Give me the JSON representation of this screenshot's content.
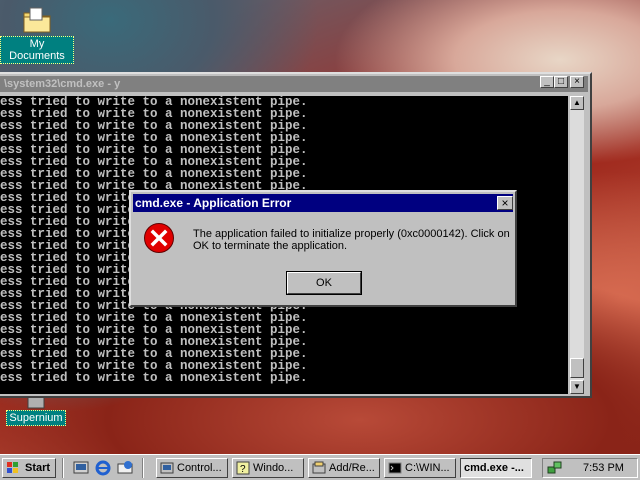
{
  "desktop": {
    "icons": [
      {
        "label": "My Documents"
      },
      {
        "label": "Supernium"
      }
    ]
  },
  "console": {
    "title": "\\system32\\cmd.exe - y",
    "lines": [
      "ess tried to write to a nonexistent pipe.",
      "ess tried to write to a nonexistent pipe.",
      "ess tried to write to a nonexistent pipe.",
      "ess tried to write to a nonexistent pipe.",
      "ess tried to write to a nonexistent pipe.",
      "ess tried to write to a nonexistent pipe.",
      "ess tried to write to a nonexistent pipe.",
      "ess tried to write to a nonexistent pipe.",
      "ess tried to write to a nonexistent pipe.",
      "ess tried to write to a nonexistent pipe.",
      "ess tried to write to a nonexistent pipe.",
      "ess tried to write to a nonexistent pipe.",
      "ess tried to write to a nonexistent pipe.",
      "ess tried to write to a nonexistent pipe.",
      "ess tried to write to a nonexistent pipe.",
      "ess tried to write to a nonexistent pipe.",
      "ess tried to write to a nonexistent pipe.",
      "ess tried to write to a nonexistent pipe.",
      "ess tried to write to a nonexistent pipe.",
      "ess tried to write to a nonexistent pipe.",
      "ess tried to write to a nonexistent pipe.",
      "ess tried to write to a nonexistent pipe.",
      "ess tried to write to a nonexistent pipe.",
      "ess tried to write to a nonexistent pipe."
    ],
    "buttons": {
      "minimize": "_",
      "maximize": "□",
      "close": "×"
    }
  },
  "dialog": {
    "title": "cmd.exe - Application Error",
    "message": "The application failed to initialize properly (0xc0000142). Click on OK to terminate the application.",
    "ok_label": "OK",
    "close_glyph": "×",
    "icon": "error-icon"
  },
  "taskbar": {
    "start_label": "Start",
    "quick_launch": [
      "desktop-icon",
      "ie-icon",
      "outlook-icon"
    ],
    "tasks": [
      {
        "label": "Control...",
        "active": false
      },
      {
        "label": "Windo...",
        "active": false
      },
      {
        "label": "Add/Re...",
        "active": false
      },
      {
        "label": "C:\\WIN...",
        "active": false
      },
      {
        "label": "cmd.exe -...",
        "active": true
      }
    ],
    "clock": "7:53 PM"
  },
  "colors": {
    "titlebar_active": "#000080",
    "titlebar_inactive": "#808080",
    "error_red": "#e00000"
  }
}
